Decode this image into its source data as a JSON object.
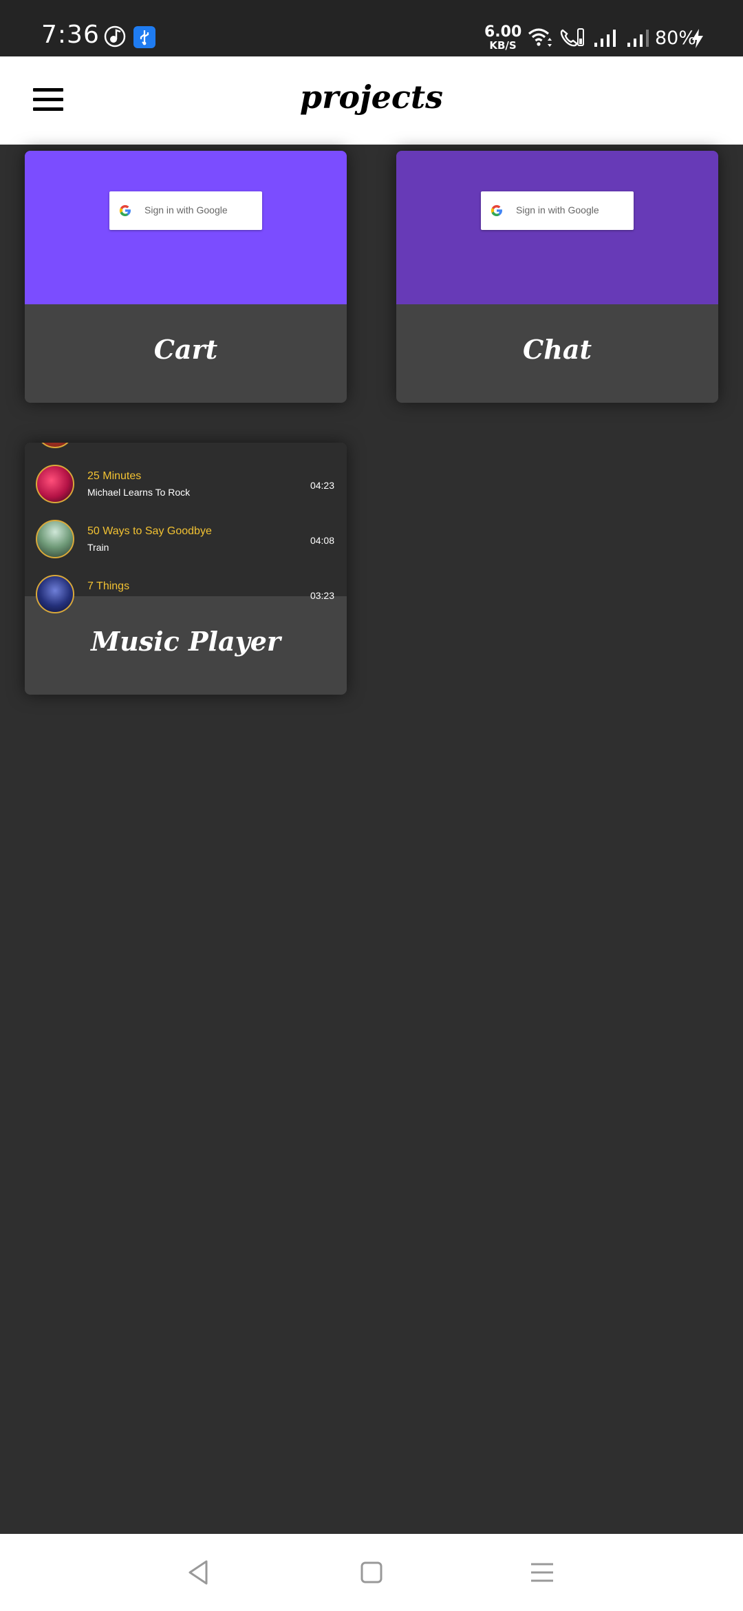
{
  "status_bar": {
    "time": "7:36",
    "speed_value": "6.00",
    "speed_unit": "KB/S",
    "battery": "80%",
    "icons": [
      "music-icon",
      "usb-icon",
      "wifi-icon",
      "call-icon",
      "signal-icon",
      "signal-icon",
      "charging-icon"
    ]
  },
  "app_bar": {
    "title": "projects",
    "menu_icon": "hamburger-menu-icon"
  },
  "projects": [
    {
      "label": "Cart",
      "preview_color": "#7b4dff",
      "signin_label": "Sign in with Google"
    },
    {
      "label": "Chat",
      "preview_color": "#673ab7",
      "signin_label": "Sign in with Google"
    },
    {
      "label": "Music Player",
      "preview_color": "#2d2d2d"
    }
  ],
  "music_tracks": [
    {
      "title": "25 Minutes",
      "artist": "Michael Learns To Rock",
      "duration": "04:23"
    },
    {
      "title": "50 Ways to Say Goodbye",
      "artist": "Train",
      "duration": "04:08"
    },
    {
      "title": "7 Things",
      "artist": "",
      "duration": "03:23"
    }
  ],
  "colors": {
    "background": "#2f2f2f",
    "card": "#444444",
    "track_title": "#f2c233"
  },
  "nav_bar": {
    "icons": [
      "back-icon",
      "home-icon",
      "recents-menu-icon"
    ]
  }
}
